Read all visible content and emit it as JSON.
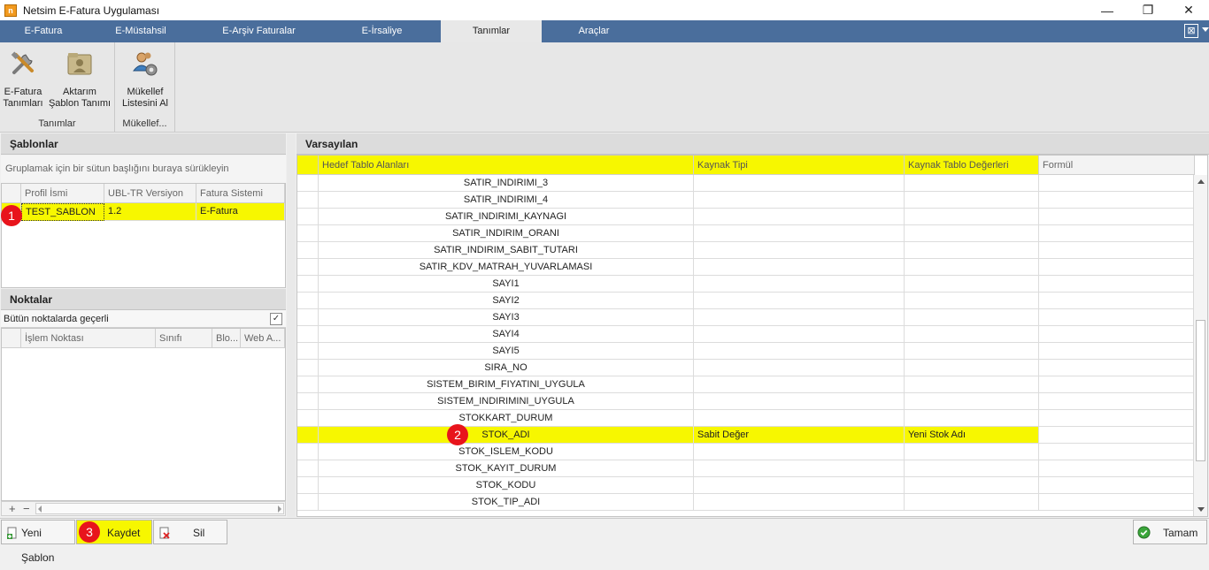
{
  "window": {
    "title": "Netsim E-Fatura Uygulaması",
    "minimize": "—",
    "maximize": "❐",
    "close": "✕"
  },
  "menu": {
    "tabs": [
      "E-Fatura",
      "E-Müstahsil",
      "E-Arşiv Faturalar",
      "E-İrsaliye",
      "Tanımlar",
      "Araçlar"
    ],
    "active": "Tanımlar",
    "close_glyph": "⊠"
  },
  "ribbon": {
    "group_tanimlar": {
      "label": "Tanımlar",
      "efatura_line1": "E-Fatura",
      "efatura_line2": "Tanımları",
      "aktarim_line1": "Aktarım",
      "aktarim_line2": "Şablon Tanımı"
    },
    "group_mukellef": {
      "label": "Mükellef...",
      "mukellef_line1": "Mükellef",
      "mukellef_line2": "Listesini Al"
    }
  },
  "sablonlar": {
    "title": "Şablonlar",
    "group_hint": "Gruplamak için bir sütun başlığını buraya sürükleyin",
    "columns": [
      "Profil İsmi",
      "UBL-TR Versiyon",
      "Fatura Sistemi"
    ],
    "rows": [
      {
        "profil": "TEST_SABLON",
        "ubl": "1.2",
        "sistem": "E-Fatura"
      }
    ],
    "add": "+",
    "remove": "−"
  },
  "noktalar": {
    "title": "Noktalar",
    "all_points": "Bütün noktalarda geçerli",
    "all_points_checked": true,
    "checkmark": "✓",
    "columns": [
      "İşlem Noktası",
      "Sınıfı",
      "Blo...",
      "Web A..."
    ]
  },
  "varsayilan": {
    "title": "Varsayılan",
    "columns": [
      "Hedef Tablo Alanları",
      "Kaynak Tipi",
      "Kaynak Tablo Değerleri",
      "Formül"
    ],
    "rows": [
      {
        "hedef": "SATIR_INDIRIMI_3",
        "tip": "",
        "deger": "",
        "formul": ""
      },
      {
        "hedef": "SATIR_INDIRIMI_4",
        "tip": "",
        "deger": "",
        "formul": ""
      },
      {
        "hedef": "SATIR_INDIRIMI_KAYNAGI",
        "tip": "",
        "deger": "",
        "formul": ""
      },
      {
        "hedef": "SATIR_INDIRIM_ORANI",
        "tip": "",
        "deger": "",
        "formul": ""
      },
      {
        "hedef": "SATIR_INDIRIM_SABIT_TUTARI",
        "tip": "",
        "deger": "",
        "formul": ""
      },
      {
        "hedef": "SATIR_KDV_MATRAH_YUVARLAMASI",
        "tip": "",
        "deger": "",
        "formul": ""
      },
      {
        "hedef": "SAYI1",
        "tip": "",
        "deger": "",
        "formul": ""
      },
      {
        "hedef": "SAYI2",
        "tip": "",
        "deger": "",
        "formul": ""
      },
      {
        "hedef": "SAYI3",
        "tip": "",
        "deger": "",
        "formul": ""
      },
      {
        "hedef": "SAYI4",
        "tip": "",
        "deger": "",
        "formul": ""
      },
      {
        "hedef": "SAYI5",
        "tip": "",
        "deger": "",
        "formul": ""
      },
      {
        "hedef": "SIRA_NO",
        "tip": "",
        "deger": "",
        "formul": ""
      },
      {
        "hedef": "SISTEM_BIRIM_FIYATINI_UYGULA",
        "tip": "",
        "deger": "",
        "formul": ""
      },
      {
        "hedef": "SISTEM_INDIRIMINI_UYGULA",
        "tip": "",
        "deger": "",
        "formul": ""
      },
      {
        "hedef": "STOKKART_DURUM",
        "tip": "",
        "deger": "",
        "formul": ""
      },
      {
        "hedef": "STOK_ADI",
        "tip": "Sabit Değer",
        "deger": "Yeni Stok Adı",
        "formul": ""
      },
      {
        "hedef": "STOK_ISLEM_KODU",
        "tip": "",
        "deger": "",
        "formul": ""
      },
      {
        "hedef": "STOK_KAYIT_DURUM",
        "tip": "",
        "deger": "",
        "formul": ""
      },
      {
        "hedef": "STOK_KODU",
        "tip": "",
        "deger": "",
        "formul": ""
      },
      {
        "hedef": "STOK_TIP_ADI",
        "tip": "",
        "deger": "",
        "formul": ""
      }
    ],
    "highlighted_row": 15
  },
  "bottom": {
    "yeni_sablon": "Yeni Şablon",
    "kaydet": "Kaydet",
    "sil": "Sil",
    "tamam": "Tamam"
  },
  "badges": [
    "1",
    "2",
    "3"
  ],
  "colors": {
    "accent": "#4a6e9c",
    "highlight": "#f7f700",
    "badge": "#e8141c"
  }
}
